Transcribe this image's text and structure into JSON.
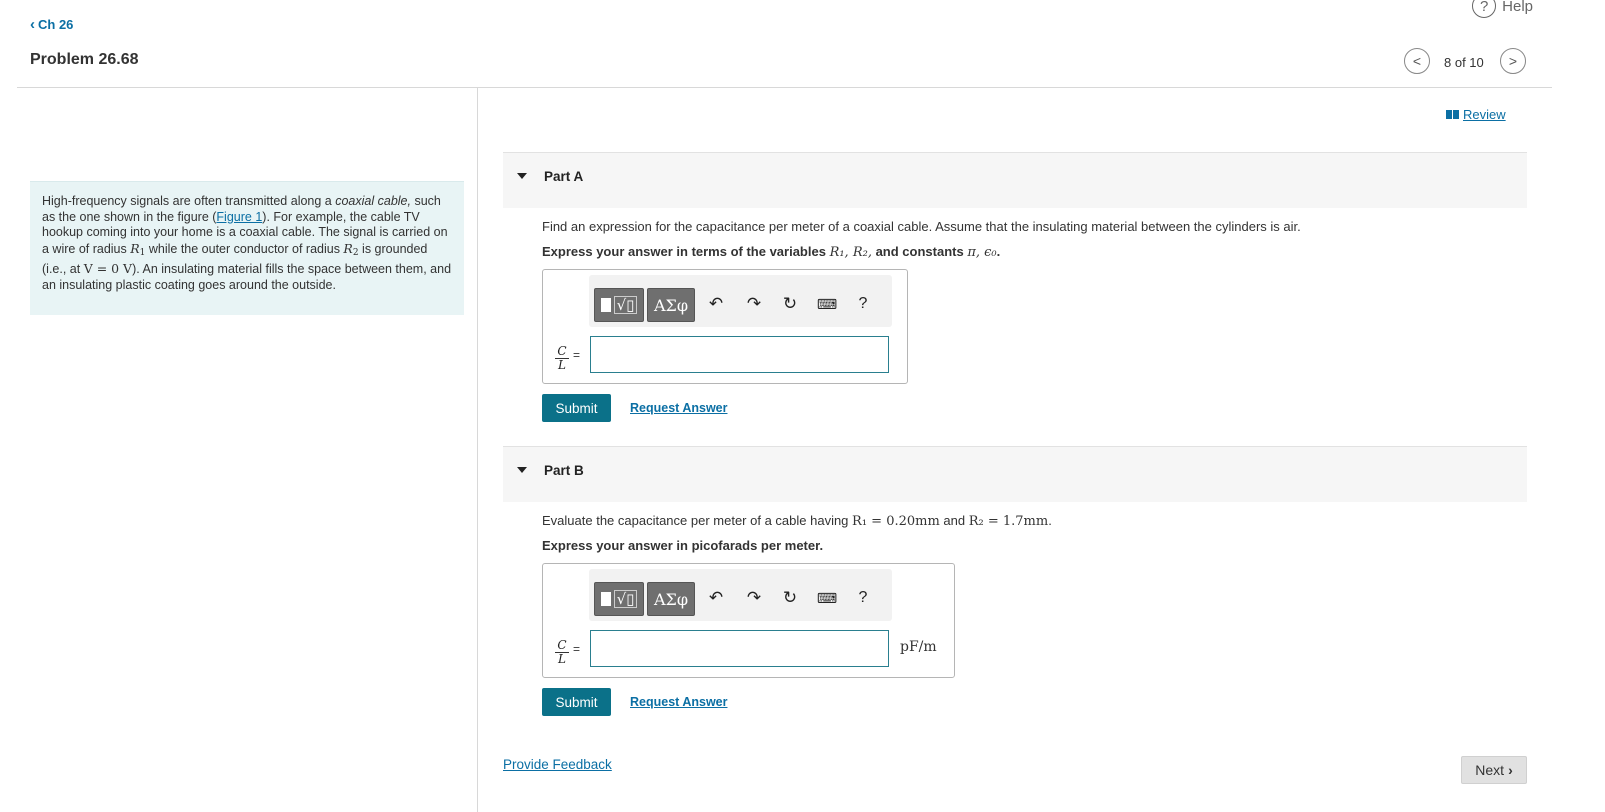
{
  "header": {
    "back_label": "Ch 26",
    "problem_title": "Problem 26.68",
    "help_label": "Help",
    "pager_text": "8 of 10",
    "review_label": "Review"
  },
  "intro": {
    "t1": "High-frequency signals are often transmitted along a ",
    "t_em": "coaxial cable,",
    "t2": " such as the one shown in the figure (",
    "figure_link": "Figure 1",
    "t3": "). For example, the cable TV hookup coming into your home is a coaxial cable. The signal is carried on a wire of radius ",
    "r1": "R",
    "r1_sub": "1",
    "t4": " while the outer conductor of radius ",
    "r2": "R",
    "r2_sub": "2",
    "t5": " is grounded (i.e., at ",
    "v_expr": "V = 0 V",
    "t6": "). An insulating material fills the space between them, and an insulating plastic coating goes around the outside."
  },
  "part_a": {
    "label": "Part A",
    "prompt": "Find an expression for the capacitance per meter of a coaxial cable. Assume that the insulating material between the cylinders is air.",
    "instr_pre": "Express your answer in terms of the variables ",
    "instr_vars": "R₁, R₂,",
    "instr_mid": " and constants ",
    "instr_consts": "π, ϵ₀",
    "instr_end": ".",
    "lhs_num": "C",
    "lhs_den": "L",
    "equals": "=",
    "submit": "Submit",
    "request": "Request Answer"
  },
  "part_b": {
    "label": "Part B",
    "prompt_pre": "Evaluate the capacitance per meter of a cable having ",
    "prompt_r1": "R₁ = 0.20mm",
    "prompt_and": " and ",
    "prompt_r2": "R₂ = 1.7mm",
    "prompt_end": ".",
    "instr": "Express your answer in picofarads per meter.",
    "lhs_num": "C",
    "lhs_den": "L",
    "equals": "=",
    "unit": "pF/m",
    "submit": "Submit",
    "request": "Request Answer"
  },
  "toolbar": {
    "greek": "ΑΣφ",
    "help": "?"
  },
  "footer": {
    "feedback": "Provide Feedback",
    "next": "Next"
  }
}
